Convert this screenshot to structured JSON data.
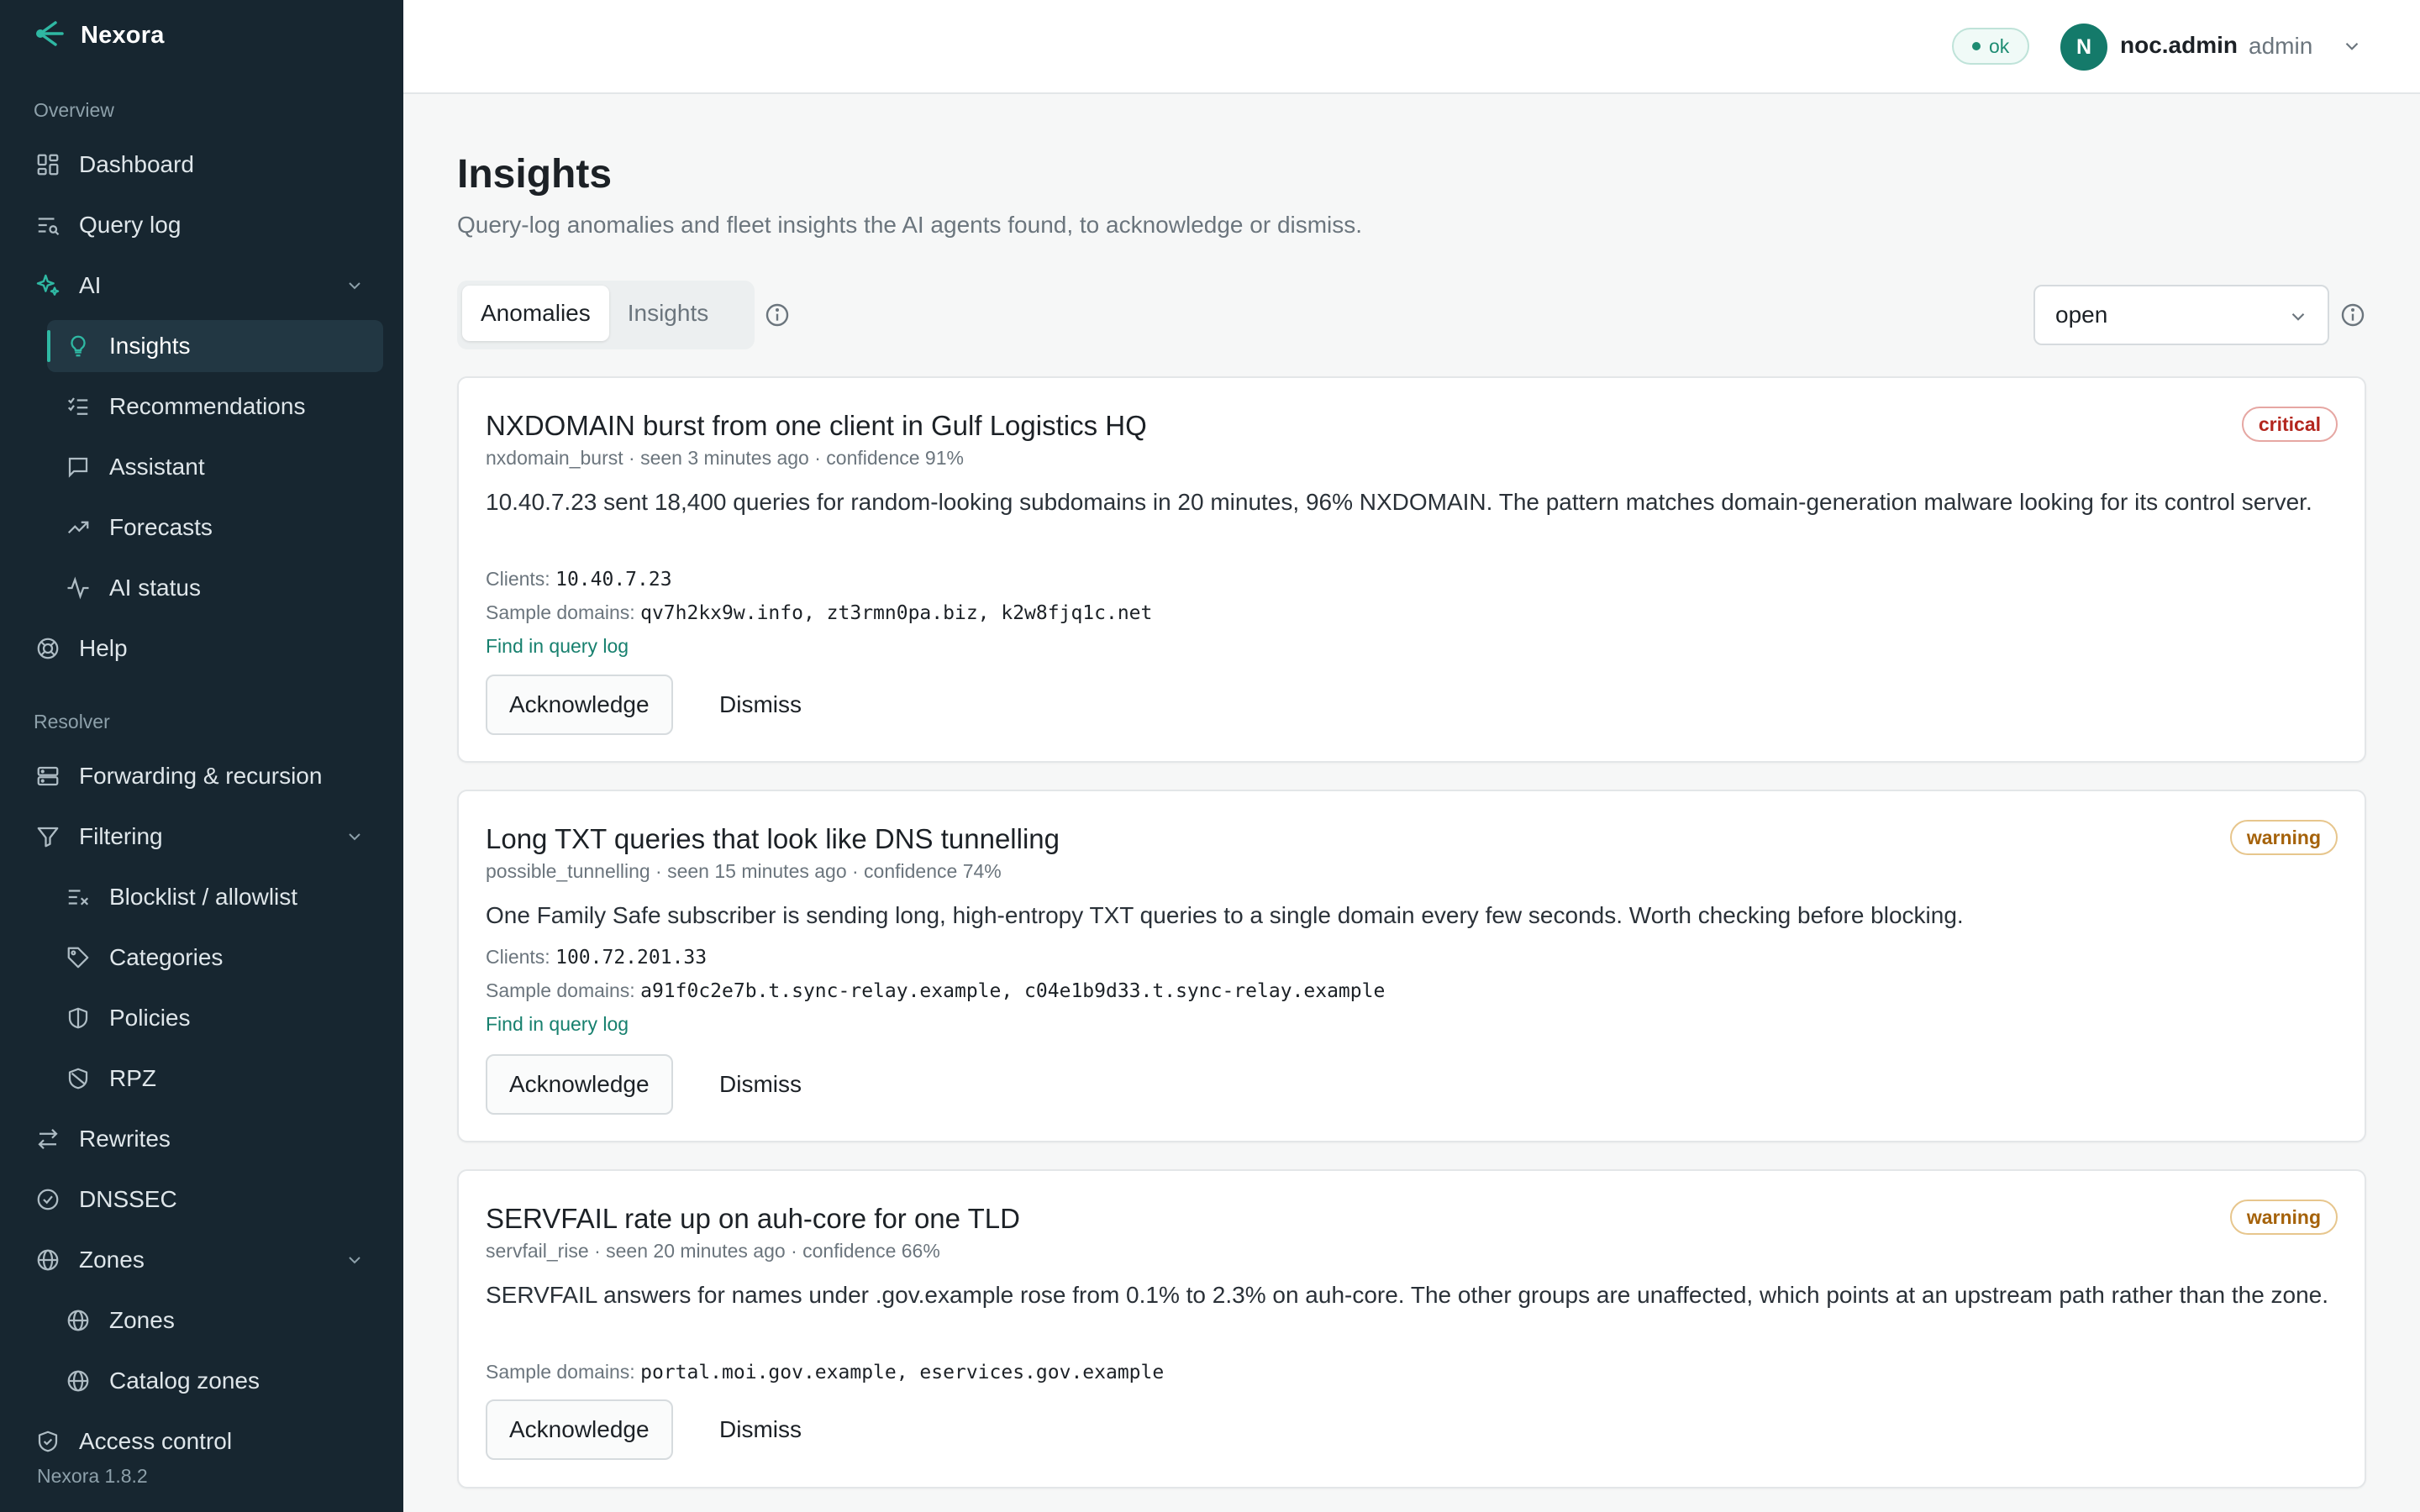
{
  "app": {
    "name": "Nexora",
    "version": "Nexora 1.8.2"
  },
  "sidebar": {
    "sections": {
      "overview": "Overview",
      "resolver": "Resolver"
    },
    "items": {
      "dashboard": "Dashboard",
      "query_log": "Query log",
      "ai": "AI",
      "insights": "Insights",
      "recommendations": "Recommendations",
      "assistant": "Assistant",
      "forecasts": "Forecasts",
      "ai_status": "AI status",
      "help": "Help",
      "forwarding": "Forwarding & recursion",
      "filtering": "Filtering",
      "blocklist": "Blocklist / allowlist",
      "categories": "Categories",
      "policies": "Policies",
      "rpz": "RPZ",
      "rewrites": "Rewrites",
      "dnssec": "DNSSEC",
      "zones": "Zones",
      "zones_sub": "Zones",
      "catalog_zones": "Catalog zones",
      "access_control": "Access control"
    }
  },
  "header": {
    "status": "ok",
    "user_initial": "N",
    "user_name": "noc.admin",
    "user_role": "admin"
  },
  "page": {
    "title": "Insights",
    "subtitle": "Query-log anomalies and fleet insights the AI agents found, to acknowledge or dismiss.",
    "tabs": [
      "Anomalies",
      "Insights"
    ],
    "filter_value": "open"
  },
  "labels": {
    "clients": "Clients:",
    "sample_domains": "Sample domains:",
    "find_link": "Find in query log",
    "acknowledge": "Acknowledge",
    "dismiss": "Dismiss"
  },
  "anomalies": [
    {
      "title": "NXDOMAIN burst from one client in Gulf Logistics HQ",
      "meta": "nxdomain_burst · seen 3 minutes ago · confidence 91%",
      "description": "10.40.7.23 sent 18,400 queries for random-looking subdomains in 20 minutes, 96% NXDOMAIN. The pattern matches domain-generation malware looking for its control server.",
      "clients": "10.40.7.23",
      "sample_domains": "qv7h2kx9w.info, zt3rmn0pa.biz, k2w8fjq1c.net",
      "severity": "critical"
    },
    {
      "title": "Long TXT queries that look like DNS tunnelling",
      "meta": "possible_tunnelling · seen 15 minutes ago · confidence 74%",
      "description": "One Family Safe subscriber is sending long, high-entropy TXT queries to a single domain every few seconds. Worth checking before blocking.",
      "clients": "100.72.201.33",
      "sample_domains": "a91f0c2e7b.t.sync-relay.example, c04e1b9d33.t.sync-relay.example",
      "severity": "warning"
    },
    {
      "title": "SERVFAIL rate up on auh-core for one TLD",
      "meta": "servfail_rise · seen 20 minutes ago · confidence 66%",
      "description": "SERVFAIL answers for names under .gov.example rose from 0.1% to 2.3% on auh-core. The other groups are unaffected, which points at an upstream path rather than the zone.",
      "sample_domains": "portal.moi.gov.example, eservices.gov.example",
      "severity": "warning"
    }
  ]
}
